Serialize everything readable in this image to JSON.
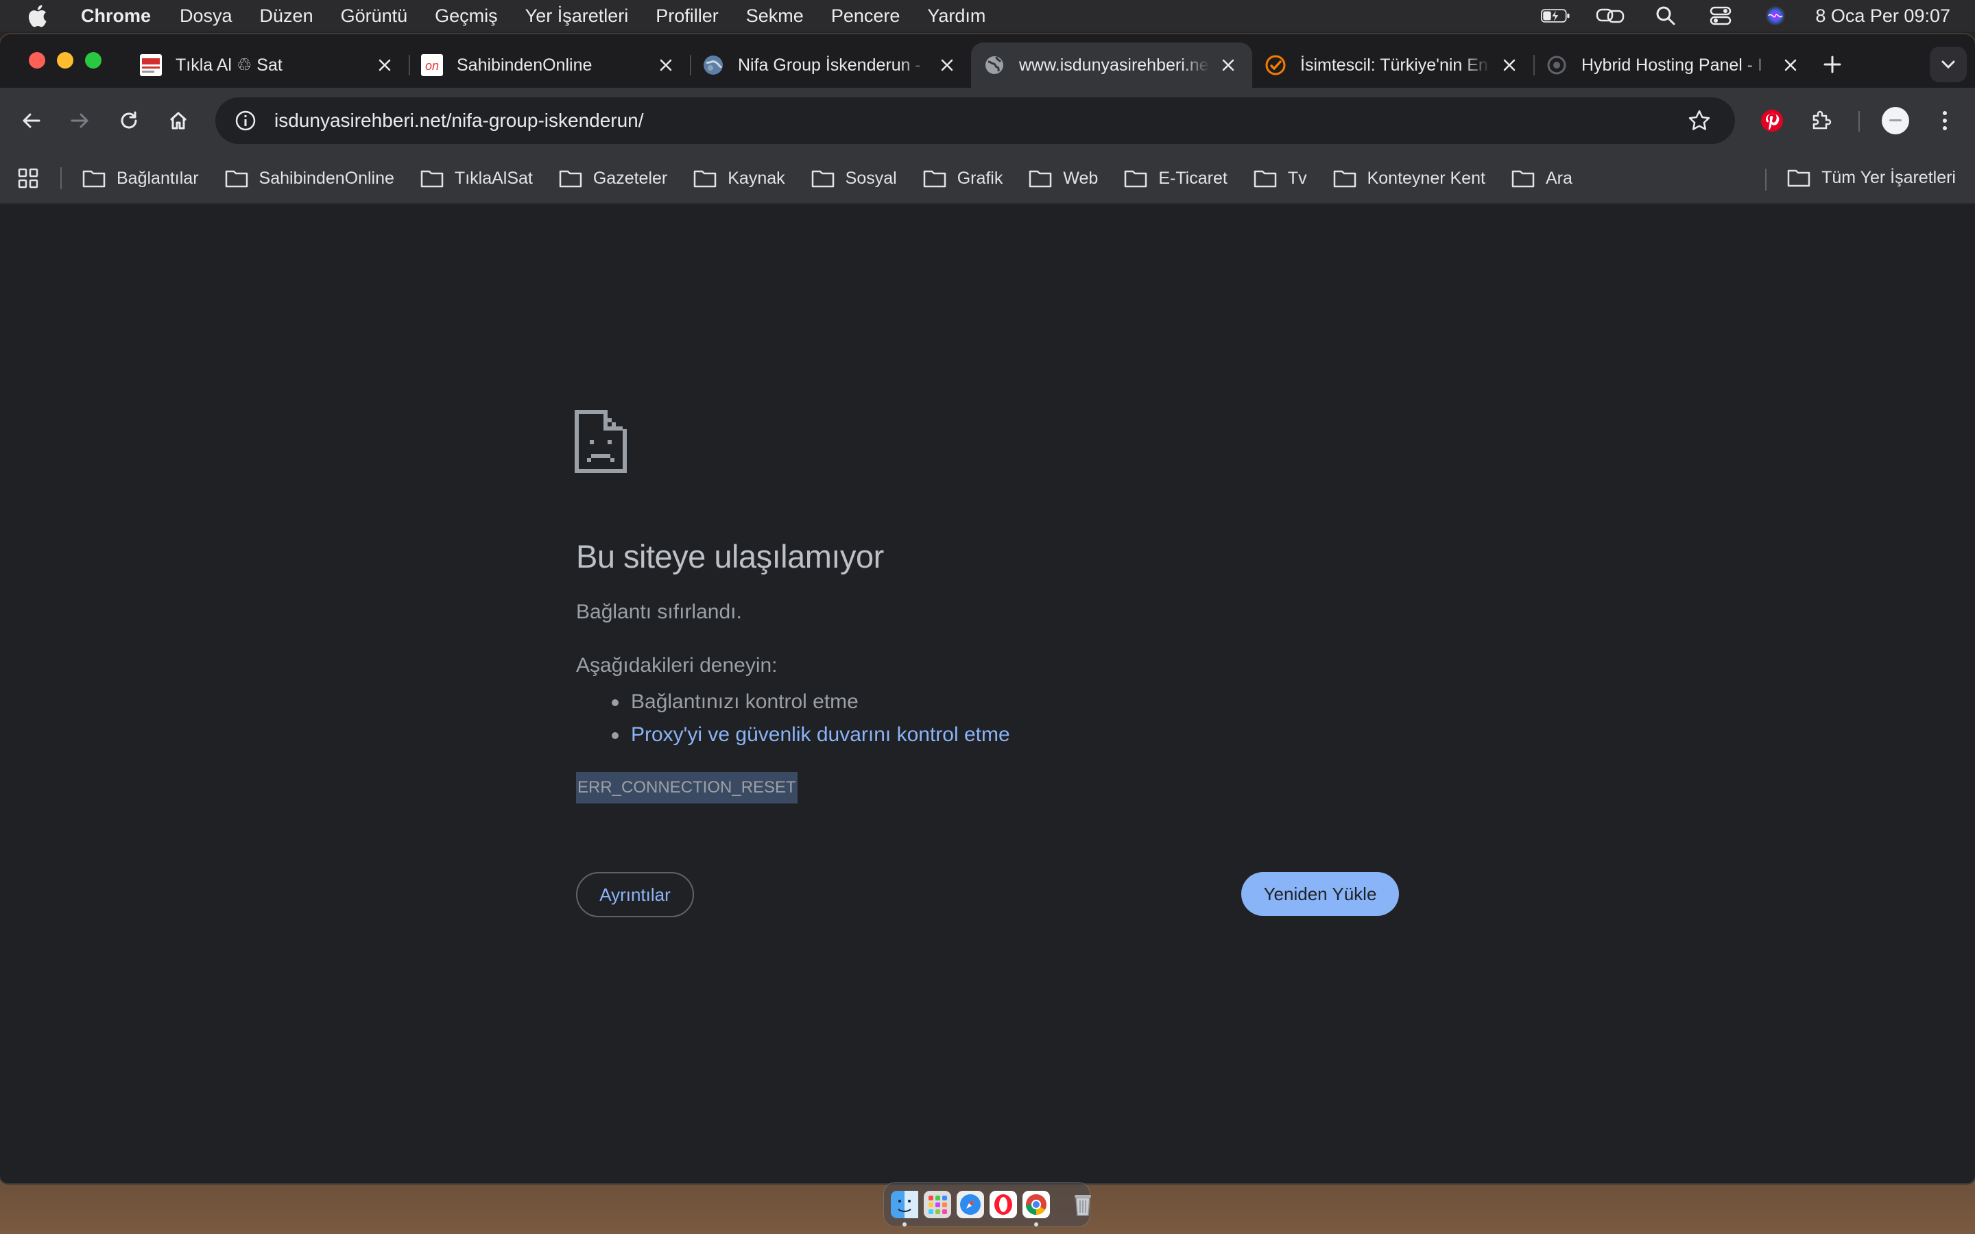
{
  "menubar": {
    "app_name": "Chrome",
    "items": [
      "Dosya",
      "Düzen",
      "Görüntü",
      "Geçmiş",
      "Yer İşaretleri",
      "Profiller",
      "Sekme",
      "Pencere",
      "Yardım"
    ],
    "clock": "8 Oca Per  09:07"
  },
  "tabs": [
    {
      "title": "Tıkla Al ♲ Sat",
      "favicon": "tiklaalsat-icon",
      "active": false
    },
    {
      "title": "SahibindenOnline",
      "favicon": "sahibindenonline-icon",
      "active": false
    },
    {
      "title": "Nifa Group İskenderun -",
      "favicon": "globe-photo-icon",
      "active": false
    },
    {
      "title": "www.isdunyasirehberi.net",
      "favicon": "globe-icon",
      "active": true
    },
    {
      "title": "İsimtescil: Türkiye'nin En",
      "favicon": "isimtescil-icon",
      "active": false
    },
    {
      "title": "Hybrid Hosting Panel - I",
      "favicon": "hosting-icon",
      "active": false
    }
  ],
  "omnibox": {
    "url": "isdunyasirehberi.net/nifa-group-iskenderun/"
  },
  "bookmarks": {
    "items": [
      "Bağlantılar",
      "SahibindenOnline",
      "TıklaAlSat",
      "Gazeteler",
      "Kaynak",
      "Sosyal",
      "Grafik",
      "Web",
      "E-Ticaret",
      "Tv",
      "Konteyner Kent",
      "Ara"
    ],
    "all_label": "Tüm Yer İşaretleri"
  },
  "error_page": {
    "title": "Bu siteye ulaşılamıyor",
    "description": "Bağlantı sıfırlandı.",
    "try_header": "Aşağıdakileri deneyin:",
    "suggestions": [
      "Bağlantınızı kontrol etme",
      "Proxy'yi ve güvenlik duvarını kontrol etme"
    ],
    "error_code": "ERR_CONNECTION_RESET",
    "details_button": "Ayrıntılar",
    "reload_button": "Yeniden Yükle"
  },
  "colors": {
    "page_bg": "#202124",
    "toolbar_bg": "#35363a",
    "link": "#8ab4f8",
    "reload_button_bg": "#8ab4f8",
    "error_code_highlight": "#3b4a63"
  }
}
